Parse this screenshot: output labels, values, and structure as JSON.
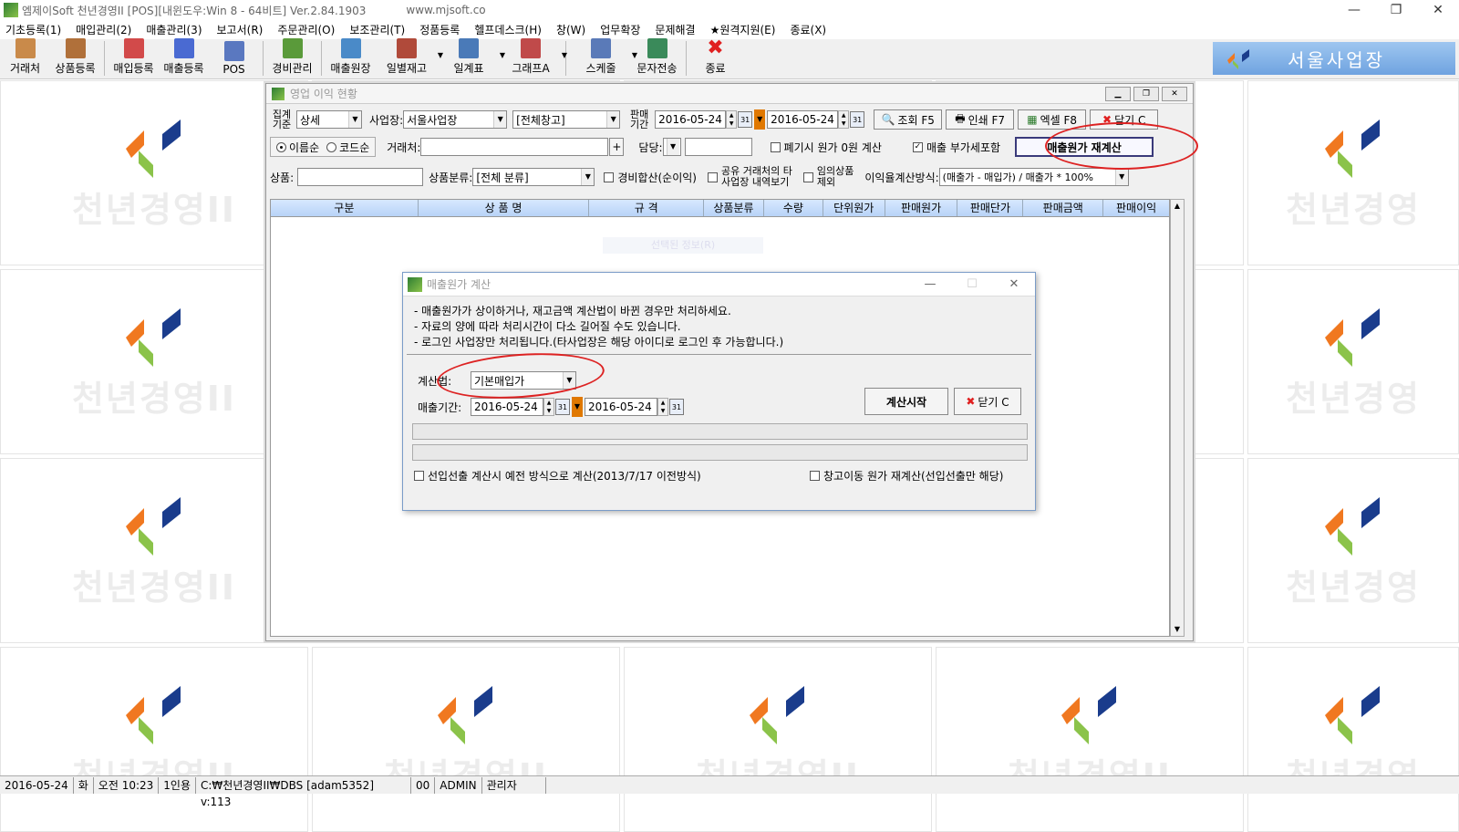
{
  "app": {
    "title": "엠제이Soft 천년경영II [POS][내윈도우:Win 8 - 64비트] Ver.2.84.1903",
    "website": "www.mjsoft.co",
    "minimize": "—",
    "maximize": "❐",
    "close": "✕"
  },
  "menu": [
    "기초등록(1)",
    "매입관리(2)",
    "매출관리(3)",
    "보고서(R)",
    "주문관리(O)",
    "보조관리(T)",
    "정품등록",
    "헬프데스크(H)",
    "창(W)",
    "업무확장",
    "문제해결",
    "★원격지원(E)",
    "종료(X)"
  ],
  "toolbar": [
    {
      "label": "거래처",
      "icon": "handshake-icon",
      "color": "#c98a4a"
    },
    {
      "label": "상품등록",
      "icon": "box-icon",
      "color": "#b0703a"
    },
    {
      "label": "매입등록",
      "icon": "purchase-icon",
      "color": "#d24a4a"
    },
    {
      "label": "매출등록",
      "icon": "sales-icon",
      "color": "#4a6ad2"
    },
    {
      "label": "POS",
      "icon": "pos-icon",
      "color": "#5a78c0"
    },
    {
      "label": "경비관리",
      "icon": "money-icon",
      "color": "#5a9a3a"
    },
    {
      "label": "매출원장",
      "icon": "ledger-icon",
      "color": "#4a8ac8"
    },
    {
      "label": "일별재고",
      "icon": "calendar-stock-icon",
      "color": "#b04a3a"
    },
    {
      "label": "일계표",
      "icon": "pencil-sheet-icon",
      "color": "#4a7ab8"
    },
    {
      "label": "그래프A",
      "icon": "bar-chart-icon",
      "color": "#c04a4a"
    },
    {
      "label": "스케줄",
      "icon": "schedule-icon",
      "color": "#5a7ab8"
    },
    {
      "label": "문자전송",
      "icon": "sms-icon",
      "color": "#3a8a5a"
    },
    {
      "label": "종료",
      "icon": "exit-x-icon",
      "color": "#e02020"
    }
  ],
  "business": {
    "name": "서울사업장"
  },
  "watermark": {
    "text": "천년경영II",
    "text_cut": "천년경영"
  },
  "main_window": {
    "title": "영업 이익 현황",
    "label_aggregate": "집계기준",
    "aggregate_value": "상세",
    "label_business": "사업장:",
    "business_value": "서울사업장",
    "warehouse_value": "[전체창고]",
    "label_sale_period": "판매기간",
    "date_from": "2016-05-24",
    "date_to": "2016-05-24",
    "btn_search": "조회 F5",
    "btn_print": "인쇄 F7",
    "btn_excel": "엑셀 F8",
    "btn_close": "닫기 C",
    "radio_name": "이름순",
    "radio_code": "코드순",
    "label_client": "거래처:",
    "client_value": "",
    "label_manager": "담당:",
    "cb_disposal": "폐기시 원가 0원 계산",
    "cb_vat": "매출 부가세포함",
    "btn_recalc": "매출원가 재계산",
    "label_product": "상품:",
    "product_value": "",
    "label_category": "상품분류:",
    "category_value": "[전체 분류]",
    "cb_expense": "경비합산(순이익)",
    "cb_shared_1": "공유 거래처의 타",
    "cb_shared_2": "사업장 내역보기",
    "cb_arbitrary_1": "임의상품",
    "cb_arbitrary_2": "제외",
    "label_rate_method": "이익율계산방식:",
    "rate_method_value": "(매출가 - 매입가) / 매출가 * 100%",
    "columns": [
      "구분",
      "상 품 명",
      "규 격",
      "상품분류",
      "수량",
      "단위원가",
      "판매원가",
      "판매단가",
      "판매금액",
      "판매이익"
    ],
    "ghost_text": "선택된 정보(R)"
  },
  "dialog": {
    "title": "매출원가 계산",
    "notes": [
      "- 매출원가가 상이하거나, 재고금액 계산법이 바뀐 경우만 처리하세요.",
      "- 자료의 양에 따라 처리시간이 다소 길어질 수도 있습니다.",
      "- 로그인 사업장만 처리됩니다.(타사업장은 해당 아이디로  로그인 후 가능합니다.)"
    ],
    "label_method": "계산법:",
    "method_value": "기본매입가",
    "label_period": "매출기간:",
    "date_from": "2016-05-24",
    "date_to": "2016-05-24",
    "btn_start": "계산시작",
    "btn_close": "닫기 C",
    "cb_old_method": "선입선출 계산시 예전 방식으로 계산(2013/7/17 이전방식)",
    "cb_transfer": "창고이동 원가 재계산(선입선출만 해당)"
  },
  "status": [
    "2016-05-24",
    "화",
    "오전 10:23",
    "1인용",
    "C:₩천년경영II₩DBS [adam5352] v:113",
    "00",
    "ADMIN",
    "관리자"
  ],
  "colors": {
    "accent_orange": "#e07800",
    "close_red": "#e02020",
    "annotation_red": "#d22222",
    "biz_blue": "#7aacea"
  }
}
